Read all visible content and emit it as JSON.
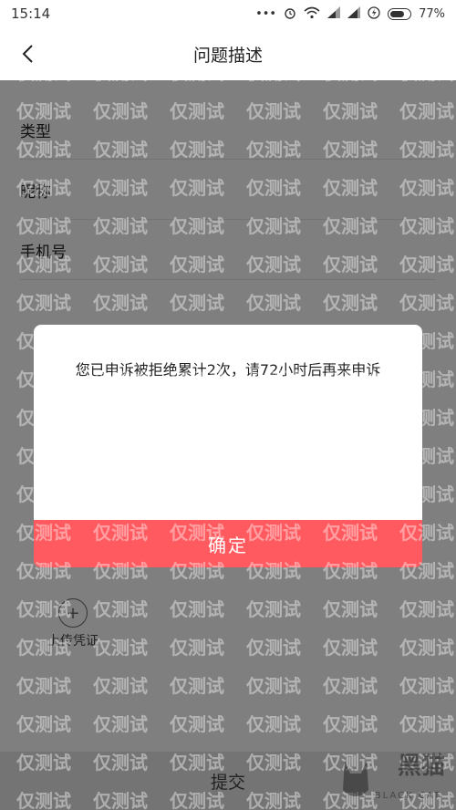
{
  "status_bar": {
    "time": "15:14",
    "dots": "•••",
    "battery_text": "77%",
    "battery_level": 0.77,
    "icons": [
      "alarm-icon",
      "wifi-icon",
      "signal-icon",
      "signal-icon",
      "charging-icon",
      "battery-icon"
    ]
  },
  "nav": {
    "back_icon": "chevron-left-icon",
    "title": "问题描述"
  },
  "form": {
    "type_label": "类型",
    "nickname_label": "昵称",
    "phone_label": "手机号",
    "upload_icon": "plus-icon",
    "upload_label": "上传凭证"
  },
  "bottom": {
    "submit_label": "提交"
  },
  "dialog": {
    "message": "您已申诉被拒绝累计2次，请72小时后再来申诉",
    "confirm_label": "确定",
    "confirm_color": "#ff5a5f"
  },
  "overlay": {
    "color": "rgba(0,0,0,0.5)"
  },
  "watermark": {
    "text": "仅测试"
  },
  "logo": {
    "text": "黑猫",
    "subtext": "BLACK CAT"
  }
}
